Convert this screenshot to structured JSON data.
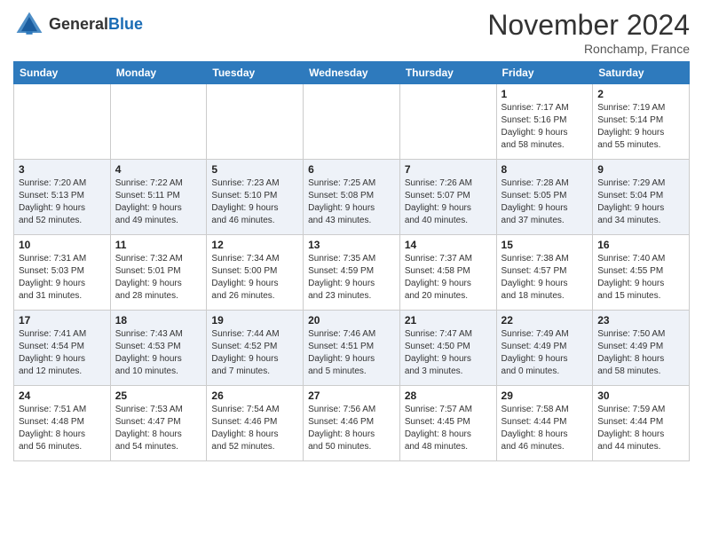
{
  "header": {
    "logo_general": "General",
    "logo_blue": "Blue",
    "month": "November 2024",
    "location": "Ronchamp, France"
  },
  "weekdays": [
    "Sunday",
    "Monday",
    "Tuesday",
    "Wednesday",
    "Thursday",
    "Friday",
    "Saturday"
  ],
  "weeks": [
    [
      {
        "day": "",
        "info": ""
      },
      {
        "day": "",
        "info": ""
      },
      {
        "day": "",
        "info": ""
      },
      {
        "day": "",
        "info": ""
      },
      {
        "day": "",
        "info": ""
      },
      {
        "day": "1",
        "info": "Sunrise: 7:17 AM\nSunset: 5:16 PM\nDaylight: 9 hours\nand 58 minutes."
      },
      {
        "day": "2",
        "info": "Sunrise: 7:19 AM\nSunset: 5:14 PM\nDaylight: 9 hours\nand 55 minutes."
      }
    ],
    [
      {
        "day": "3",
        "info": "Sunrise: 7:20 AM\nSunset: 5:13 PM\nDaylight: 9 hours\nand 52 minutes."
      },
      {
        "day": "4",
        "info": "Sunrise: 7:22 AM\nSunset: 5:11 PM\nDaylight: 9 hours\nand 49 minutes."
      },
      {
        "day": "5",
        "info": "Sunrise: 7:23 AM\nSunset: 5:10 PM\nDaylight: 9 hours\nand 46 minutes."
      },
      {
        "day": "6",
        "info": "Sunrise: 7:25 AM\nSunset: 5:08 PM\nDaylight: 9 hours\nand 43 minutes."
      },
      {
        "day": "7",
        "info": "Sunrise: 7:26 AM\nSunset: 5:07 PM\nDaylight: 9 hours\nand 40 minutes."
      },
      {
        "day": "8",
        "info": "Sunrise: 7:28 AM\nSunset: 5:05 PM\nDaylight: 9 hours\nand 37 minutes."
      },
      {
        "day": "9",
        "info": "Sunrise: 7:29 AM\nSunset: 5:04 PM\nDaylight: 9 hours\nand 34 minutes."
      }
    ],
    [
      {
        "day": "10",
        "info": "Sunrise: 7:31 AM\nSunset: 5:03 PM\nDaylight: 9 hours\nand 31 minutes."
      },
      {
        "day": "11",
        "info": "Sunrise: 7:32 AM\nSunset: 5:01 PM\nDaylight: 9 hours\nand 28 minutes."
      },
      {
        "day": "12",
        "info": "Sunrise: 7:34 AM\nSunset: 5:00 PM\nDaylight: 9 hours\nand 26 minutes."
      },
      {
        "day": "13",
        "info": "Sunrise: 7:35 AM\nSunset: 4:59 PM\nDaylight: 9 hours\nand 23 minutes."
      },
      {
        "day": "14",
        "info": "Sunrise: 7:37 AM\nSunset: 4:58 PM\nDaylight: 9 hours\nand 20 minutes."
      },
      {
        "day": "15",
        "info": "Sunrise: 7:38 AM\nSunset: 4:57 PM\nDaylight: 9 hours\nand 18 minutes."
      },
      {
        "day": "16",
        "info": "Sunrise: 7:40 AM\nSunset: 4:55 PM\nDaylight: 9 hours\nand 15 minutes."
      }
    ],
    [
      {
        "day": "17",
        "info": "Sunrise: 7:41 AM\nSunset: 4:54 PM\nDaylight: 9 hours\nand 12 minutes."
      },
      {
        "day": "18",
        "info": "Sunrise: 7:43 AM\nSunset: 4:53 PM\nDaylight: 9 hours\nand 10 minutes."
      },
      {
        "day": "19",
        "info": "Sunrise: 7:44 AM\nSunset: 4:52 PM\nDaylight: 9 hours\nand 7 minutes."
      },
      {
        "day": "20",
        "info": "Sunrise: 7:46 AM\nSunset: 4:51 PM\nDaylight: 9 hours\nand 5 minutes."
      },
      {
        "day": "21",
        "info": "Sunrise: 7:47 AM\nSunset: 4:50 PM\nDaylight: 9 hours\nand 3 minutes."
      },
      {
        "day": "22",
        "info": "Sunrise: 7:49 AM\nSunset: 4:49 PM\nDaylight: 9 hours\nand 0 minutes."
      },
      {
        "day": "23",
        "info": "Sunrise: 7:50 AM\nSunset: 4:49 PM\nDaylight: 8 hours\nand 58 minutes."
      }
    ],
    [
      {
        "day": "24",
        "info": "Sunrise: 7:51 AM\nSunset: 4:48 PM\nDaylight: 8 hours\nand 56 minutes."
      },
      {
        "day": "25",
        "info": "Sunrise: 7:53 AM\nSunset: 4:47 PM\nDaylight: 8 hours\nand 54 minutes."
      },
      {
        "day": "26",
        "info": "Sunrise: 7:54 AM\nSunset: 4:46 PM\nDaylight: 8 hours\nand 52 minutes."
      },
      {
        "day": "27",
        "info": "Sunrise: 7:56 AM\nSunset: 4:46 PM\nDaylight: 8 hours\nand 50 minutes."
      },
      {
        "day": "28",
        "info": "Sunrise: 7:57 AM\nSunset: 4:45 PM\nDaylight: 8 hours\nand 48 minutes."
      },
      {
        "day": "29",
        "info": "Sunrise: 7:58 AM\nSunset: 4:44 PM\nDaylight: 8 hours\nand 46 minutes."
      },
      {
        "day": "30",
        "info": "Sunrise: 7:59 AM\nSunset: 4:44 PM\nDaylight: 8 hours\nand 44 minutes."
      }
    ]
  ]
}
